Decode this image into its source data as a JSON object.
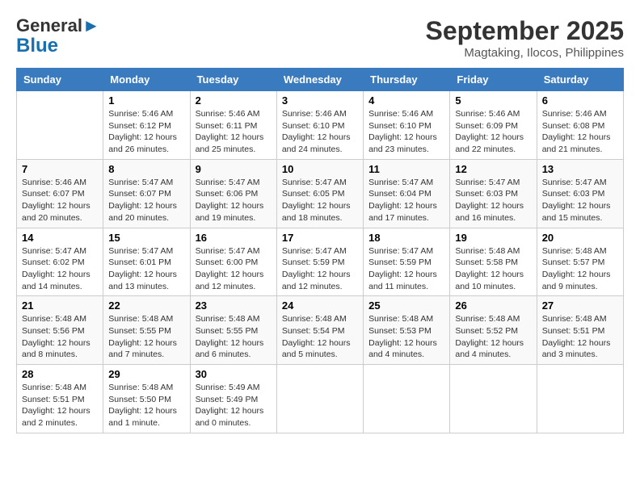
{
  "header": {
    "logo_general": "General",
    "logo_blue": "Blue",
    "month_title": "September 2025",
    "location": "Magtaking, Ilocos, Philippines"
  },
  "weekdays": [
    "Sunday",
    "Monday",
    "Tuesday",
    "Wednesday",
    "Thursday",
    "Friday",
    "Saturday"
  ],
  "weeks": [
    [
      {
        "day": "",
        "sunrise": "",
        "sunset": "",
        "daylight": ""
      },
      {
        "day": "1",
        "sunrise": "Sunrise: 5:46 AM",
        "sunset": "Sunset: 6:12 PM",
        "daylight": "Daylight: 12 hours and 26 minutes."
      },
      {
        "day": "2",
        "sunrise": "Sunrise: 5:46 AM",
        "sunset": "Sunset: 6:11 PM",
        "daylight": "Daylight: 12 hours and 25 minutes."
      },
      {
        "day": "3",
        "sunrise": "Sunrise: 5:46 AM",
        "sunset": "Sunset: 6:10 PM",
        "daylight": "Daylight: 12 hours and 24 minutes."
      },
      {
        "day": "4",
        "sunrise": "Sunrise: 5:46 AM",
        "sunset": "Sunset: 6:10 PM",
        "daylight": "Daylight: 12 hours and 23 minutes."
      },
      {
        "day": "5",
        "sunrise": "Sunrise: 5:46 AM",
        "sunset": "Sunset: 6:09 PM",
        "daylight": "Daylight: 12 hours and 22 minutes."
      },
      {
        "day": "6",
        "sunrise": "Sunrise: 5:46 AM",
        "sunset": "Sunset: 6:08 PM",
        "daylight": "Daylight: 12 hours and 21 minutes."
      }
    ],
    [
      {
        "day": "7",
        "sunrise": "Sunrise: 5:46 AM",
        "sunset": "Sunset: 6:07 PM",
        "daylight": "Daylight: 12 hours and 20 minutes."
      },
      {
        "day": "8",
        "sunrise": "Sunrise: 5:47 AM",
        "sunset": "Sunset: 6:07 PM",
        "daylight": "Daylight: 12 hours and 20 minutes."
      },
      {
        "day": "9",
        "sunrise": "Sunrise: 5:47 AM",
        "sunset": "Sunset: 6:06 PM",
        "daylight": "Daylight: 12 hours and 19 minutes."
      },
      {
        "day": "10",
        "sunrise": "Sunrise: 5:47 AM",
        "sunset": "Sunset: 6:05 PM",
        "daylight": "Daylight: 12 hours and 18 minutes."
      },
      {
        "day": "11",
        "sunrise": "Sunrise: 5:47 AM",
        "sunset": "Sunset: 6:04 PM",
        "daylight": "Daylight: 12 hours and 17 minutes."
      },
      {
        "day": "12",
        "sunrise": "Sunrise: 5:47 AM",
        "sunset": "Sunset: 6:03 PM",
        "daylight": "Daylight: 12 hours and 16 minutes."
      },
      {
        "day": "13",
        "sunrise": "Sunrise: 5:47 AM",
        "sunset": "Sunset: 6:03 PM",
        "daylight": "Daylight: 12 hours and 15 minutes."
      }
    ],
    [
      {
        "day": "14",
        "sunrise": "Sunrise: 5:47 AM",
        "sunset": "Sunset: 6:02 PM",
        "daylight": "Daylight: 12 hours and 14 minutes."
      },
      {
        "day": "15",
        "sunrise": "Sunrise: 5:47 AM",
        "sunset": "Sunset: 6:01 PM",
        "daylight": "Daylight: 12 hours and 13 minutes."
      },
      {
        "day": "16",
        "sunrise": "Sunrise: 5:47 AM",
        "sunset": "Sunset: 6:00 PM",
        "daylight": "Daylight: 12 hours and 12 minutes."
      },
      {
        "day": "17",
        "sunrise": "Sunrise: 5:47 AM",
        "sunset": "Sunset: 5:59 PM",
        "daylight": "Daylight: 12 hours and 12 minutes."
      },
      {
        "day": "18",
        "sunrise": "Sunrise: 5:47 AM",
        "sunset": "Sunset: 5:59 PM",
        "daylight": "Daylight: 12 hours and 11 minutes."
      },
      {
        "day": "19",
        "sunrise": "Sunrise: 5:48 AM",
        "sunset": "Sunset: 5:58 PM",
        "daylight": "Daylight: 12 hours and 10 minutes."
      },
      {
        "day": "20",
        "sunrise": "Sunrise: 5:48 AM",
        "sunset": "Sunset: 5:57 PM",
        "daylight": "Daylight: 12 hours and 9 minutes."
      }
    ],
    [
      {
        "day": "21",
        "sunrise": "Sunrise: 5:48 AM",
        "sunset": "Sunset: 5:56 PM",
        "daylight": "Daylight: 12 hours and 8 minutes."
      },
      {
        "day": "22",
        "sunrise": "Sunrise: 5:48 AM",
        "sunset": "Sunset: 5:55 PM",
        "daylight": "Daylight: 12 hours and 7 minutes."
      },
      {
        "day": "23",
        "sunrise": "Sunrise: 5:48 AM",
        "sunset": "Sunset: 5:55 PM",
        "daylight": "Daylight: 12 hours and 6 minutes."
      },
      {
        "day": "24",
        "sunrise": "Sunrise: 5:48 AM",
        "sunset": "Sunset: 5:54 PM",
        "daylight": "Daylight: 12 hours and 5 minutes."
      },
      {
        "day": "25",
        "sunrise": "Sunrise: 5:48 AM",
        "sunset": "Sunset: 5:53 PM",
        "daylight": "Daylight: 12 hours and 4 minutes."
      },
      {
        "day": "26",
        "sunrise": "Sunrise: 5:48 AM",
        "sunset": "Sunset: 5:52 PM",
        "daylight": "Daylight: 12 hours and 4 minutes."
      },
      {
        "day": "27",
        "sunrise": "Sunrise: 5:48 AM",
        "sunset": "Sunset: 5:51 PM",
        "daylight": "Daylight: 12 hours and 3 minutes."
      }
    ],
    [
      {
        "day": "28",
        "sunrise": "Sunrise: 5:48 AM",
        "sunset": "Sunset: 5:51 PM",
        "daylight": "Daylight: 12 hours and 2 minutes."
      },
      {
        "day": "29",
        "sunrise": "Sunrise: 5:48 AM",
        "sunset": "Sunset: 5:50 PM",
        "daylight": "Daylight: 12 hours and 1 minute."
      },
      {
        "day": "30",
        "sunrise": "Sunrise: 5:49 AM",
        "sunset": "Sunset: 5:49 PM",
        "daylight": "Daylight: 12 hours and 0 minutes."
      },
      {
        "day": "",
        "sunrise": "",
        "sunset": "",
        "daylight": ""
      },
      {
        "day": "",
        "sunrise": "",
        "sunset": "",
        "daylight": ""
      },
      {
        "day": "",
        "sunrise": "",
        "sunset": "",
        "daylight": ""
      },
      {
        "day": "",
        "sunrise": "",
        "sunset": "",
        "daylight": ""
      }
    ]
  ]
}
